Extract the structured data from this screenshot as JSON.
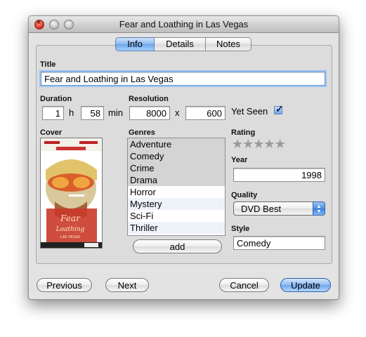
{
  "window": {
    "title": "Fear and Loathing in Las Vegas"
  },
  "tabs": [
    {
      "label": "Info",
      "active": true
    },
    {
      "label": "Details",
      "active": false
    },
    {
      "label": "Notes",
      "active": false
    }
  ],
  "form": {
    "title_label": "Title",
    "title_value": "Fear and Loathing in Las Vegas",
    "duration_label": "Duration",
    "duration_hours": "1",
    "hours_unit": "h",
    "duration_minutes": "58",
    "minutes_unit": "min",
    "resolution_label": "Resolution",
    "resolution_width": "8000",
    "resolution_sep": "x",
    "resolution_height": "600",
    "yet_seen_label": "Yet Seen",
    "yet_seen_checked": true,
    "cover_label": "Cover",
    "genres_label": "Genres",
    "genres": [
      {
        "name": "Adventure",
        "selected": true
      },
      {
        "name": "Comedy",
        "selected": true
      },
      {
        "name": "Crime",
        "selected": true
      },
      {
        "name": "Drama",
        "selected": true
      },
      {
        "name": "Horror",
        "selected": false
      },
      {
        "name": "Mystery",
        "selected": false
      },
      {
        "name": "Sci-Fi",
        "selected": false
      },
      {
        "name": "Thriller",
        "selected": false
      }
    ],
    "add_label": "add",
    "rating_label": "Rating",
    "rating_value": 0,
    "rating_max": 5,
    "year_label": "Year",
    "year_value": "1998",
    "quality_label": "Quality",
    "quality_value": "DVD Best",
    "style_label": "Style",
    "style_value": "Comedy"
  },
  "buttons": {
    "previous": "Previous",
    "next": "Next",
    "cancel": "Cancel",
    "update": "Update"
  },
  "colors": {
    "accent": "#6fa6ea",
    "window_bg": "#e3e3e3"
  },
  "icons": [
    "close-icon",
    "minimize-icon",
    "zoom-icon",
    "checkmark-icon",
    "star-icon",
    "stepper-arrows-icon"
  ]
}
